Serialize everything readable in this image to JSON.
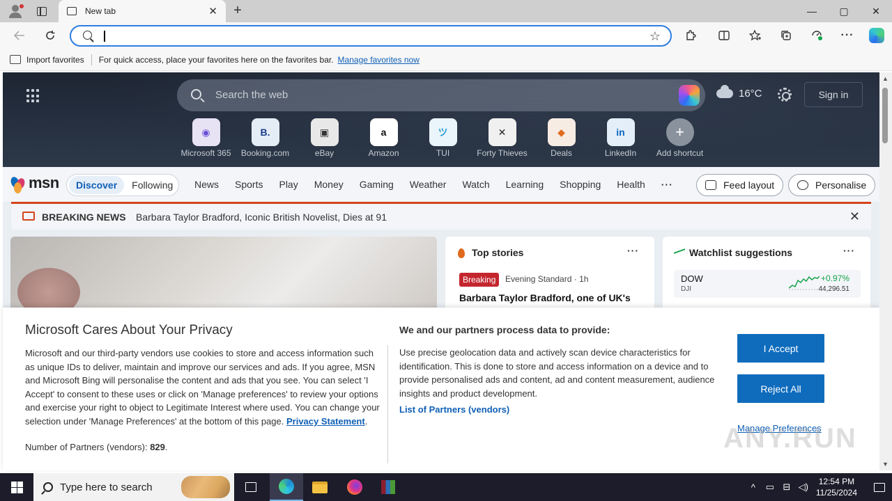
{
  "browser": {
    "tab_title": "New tab",
    "tab_close": "✕",
    "new_tab": "+",
    "window_controls": {
      "minimize": "—",
      "maximize": "▢",
      "close": "✕"
    },
    "address_value": "",
    "favorites_star": "☆",
    "toolbar_icons": [
      "back-arrow-icon",
      "refresh-icon",
      "extensions-icon",
      "split-screen-icon",
      "favorites-icon",
      "collections-icon",
      "performance-icon",
      "more-icon",
      "copilot-icon"
    ]
  },
  "favbar": {
    "import": "Import favorites",
    "message": "For quick access, place your favorites here on the favorites bar.",
    "manage_link": "Manage favorites now"
  },
  "hero": {
    "search_placeholder": "Search the web",
    "temperature": "16°C",
    "signin": "Sign in",
    "shortcuts": [
      {
        "label": "Microsoft 365",
        "glyph": "◉",
        "color": "#e8e2f5",
        "fg": "#6b4fd8"
      },
      {
        "label": "Booking.com",
        "glyph": "B.",
        "color": "#e4ecf6",
        "fg": "#1a3f8a"
      },
      {
        "label": "eBay",
        "glyph": "▣",
        "color": "#e8e8e8",
        "fg": "#333333"
      },
      {
        "label": "Amazon",
        "glyph": "a",
        "color": "#ffffff",
        "fg": "#111111"
      },
      {
        "label": "TUI",
        "glyph": "ツ",
        "color": "#eaf4fb",
        "fg": "#2a9fd6"
      },
      {
        "label": "Forty Thieves",
        "glyph": "✕",
        "color": "#f0f0f0",
        "fg": "#222222"
      },
      {
        "label": "Deals",
        "glyph": "◆",
        "color": "#f7ece4",
        "fg": "#e06a1e"
      },
      {
        "label": "LinkedIn",
        "glyph": "in",
        "color": "#e4eef8",
        "fg": "#0a66c2"
      },
      {
        "label": "Add shortcut",
        "glyph": "+",
        "color": "#8a929d",
        "fg": "#ffffff"
      }
    ]
  },
  "msn": {
    "logo": "msn",
    "toggle_on": "Discover",
    "toggle_off": "Following",
    "categories": [
      "News",
      "Sports",
      "Play",
      "Money",
      "Gaming",
      "Weather",
      "Watch",
      "Learning",
      "Shopping",
      "Health"
    ],
    "more": "···",
    "feed_layout": "Feed layout",
    "personalise": "Personalise"
  },
  "breaking": {
    "label": "BREAKING NEWS",
    "headline": "Barbara Taylor Bradford, Iconic British Novelist, Dies at 91",
    "close": "✕"
  },
  "top_stories": {
    "title": "Top stories",
    "more": "···",
    "badge": "Breaking",
    "source": "Evening Standard · 1h",
    "headline": "Barbara Taylor Bradford, one of UK's"
  },
  "watchlist": {
    "title": "Watchlist suggestions",
    "more": "···",
    "symbol": "DOW",
    "exchange": "DJI",
    "change": "+0.97%",
    "price": "44,296.51"
  },
  "privacy": {
    "title": "Microsoft Cares About Your Privacy",
    "body": "Microsoft and our third-party vendors use cookies to store and access information such as unique IDs to deliver, maintain and improve our services and ads. If you agree, MSN and Microsoft Bing will personalise the content and ads that you see. You can select 'I Accept' to consent to these uses or click on 'Manage preferences' to review your options and exercise your right to object to Legitimate Interest where used.  You can change your selection under 'Manage Preferences' at the bottom of this page.",
    "privacy_link": "Privacy Statement",
    "partners_label": "Number of Partners (vendors):",
    "partners_count": "829",
    "heading2": "We and our partners process data to provide:",
    "body2": "Use precise geolocation data and actively scan device characteristics for identification. This is done to store and access information on a device and to provide personalised ads and content, ad and content measurement, audience insights and product development.",
    "partners_link": "List of Partners (vendors)",
    "accept": "I Accept",
    "reject": "Reject All",
    "manage": "Manage Preferences"
  },
  "watermark": "ANY.RUN",
  "taskbar": {
    "search_placeholder": "Type here to search",
    "time": "12:54 PM",
    "date": "11/25/2024",
    "tray_icons": [
      "chevron-up-icon",
      "network-icon",
      "volume-icon"
    ]
  }
}
